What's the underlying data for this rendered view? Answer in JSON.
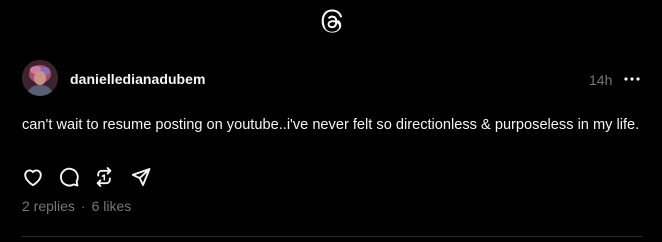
{
  "header": {
    "logo_icon": "threads-logo-icon"
  },
  "post": {
    "username": "danielledianadubem",
    "timestamp": "14h",
    "text": "can't wait to resume posting on youtube..i've never felt so directionless & purposeless in my life.",
    "actions": [
      "like-icon",
      "reply-icon",
      "repost-icon",
      "share-icon"
    ],
    "replies": "2 replies",
    "separator": "·",
    "likes": "6 likes"
  },
  "colors": {
    "background": "#000000",
    "text": "#f3f5f7",
    "muted": "#777777",
    "divider": "#2a2a2a"
  }
}
